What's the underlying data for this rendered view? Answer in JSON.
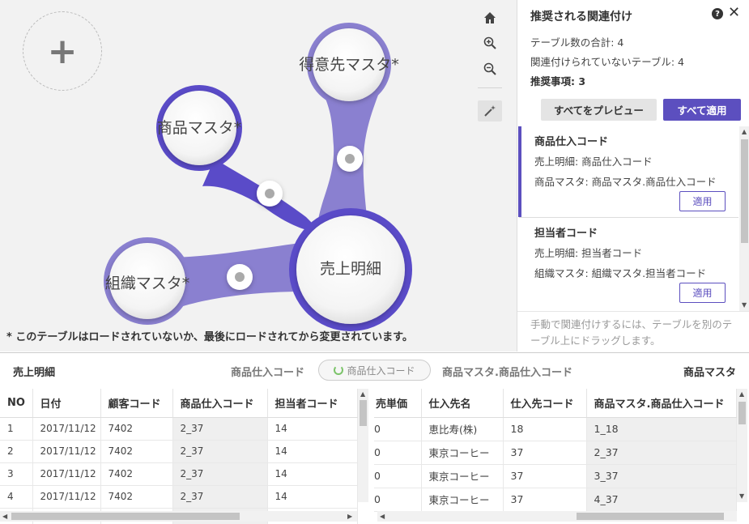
{
  "canvas": {
    "add_label": "+",
    "bubbles": {
      "center": "売上明細",
      "product": "商品マスタ*",
      "customer": "得意先マスタ*",
      "org": "組織マスタ*"
    },
    "footnote": "* このテーブルはロードされていないか、最後にロードされてから変更されています。"
  },
  "panel": {
    "title": "推奨される関連付け",
    "help": "?",
    "close": "✕",
    "stats": {
      "total": "テーブル数の合計: 4",
      "unassociated": "関連付けられていないテーブル: 4",
      "recommendations": "推奨事項: 3"
    },
    "preview_all_label": "すべてをプレビュー",
    "apply_all_label": "すべて適用",
    "recommendations": [
      {
        "title": "商品仕入コード",
        "line1": "売上明細: 商品仕入コード",
        "line2": "商品マスタ: 商品マスタ.商品仕入コード",
        "apply_label": "適用"
      },
      {
        "title": "担当者コード",
        "line1": "売上明細: 担当者コード",
        "line2": "組織マスタ: 組織マスタ.担当者コード",
        "apply_label": "適用"
      }
    ],
    "hint": "手動で関連付けするには、テーブルを別のテーブル上にドラッグします。"
  },
  "preview": {
    "left_table": "売上明細",
    "left_key": "商品仕入コード",
    "pill_label": "商品仕入コード",
    "right_key": "商品マスタ.商品仕入コード",
    "right_table": "商品マスタ",
    "left_columns": [
      "NO",
      "日付",
      "顧客コード",
      "商品仕入コード",
      "担当者コード"
    ],
    "left_rows": [
      [
        "1",
        "2017/11/12",
        "7402",
        "2_37",
        "14"
      ],
      [
        "2",
        "2017/11/12",
        "7402",
        "2_37",
        "14"
      ],
      [
        "3",
        "2017/11/12",
        "7402",
        "2_37",
        "14"
      ],
      [
        "4",
        "2017/11/12",
        "7402",
        "2_37",
        "14"
      ],
      [
        "",
        "",
        "",
        "",
        ""
      ]
    ],
    "right_columns": [
      "売単価",
      "仕入先名",
      "仕入先コード",
      "商品マスタ.商品仕入コード"
    ],
    "right_rows": [
      [
        "0",
        "恵比寿(株)",
        "18",
        "1_18"
      ],
      [
        "0",
        "東京コーヒー",
        "37",
        "2_37"
      ],
      [
        "0",
        "東京コーヒー",
        "37",
        "3_37"
      ],
      [
        "0",
        "東京コーヒー",
        "37",
        "4_37"
      ]
    ]
  },
  "colors": {
    "accent": "#5c4fbf",
    "link_dark": "#5a4bc8",
    "link_light": "#8a80d0"
  },
  "icons": [
    "plus-icon",
    "home-icon",
    "zoom-in-icon",
    "zoom-out-icon",
    "magic-wand-icon",
    "help-icon",
    "close-icon"
  ]
}
